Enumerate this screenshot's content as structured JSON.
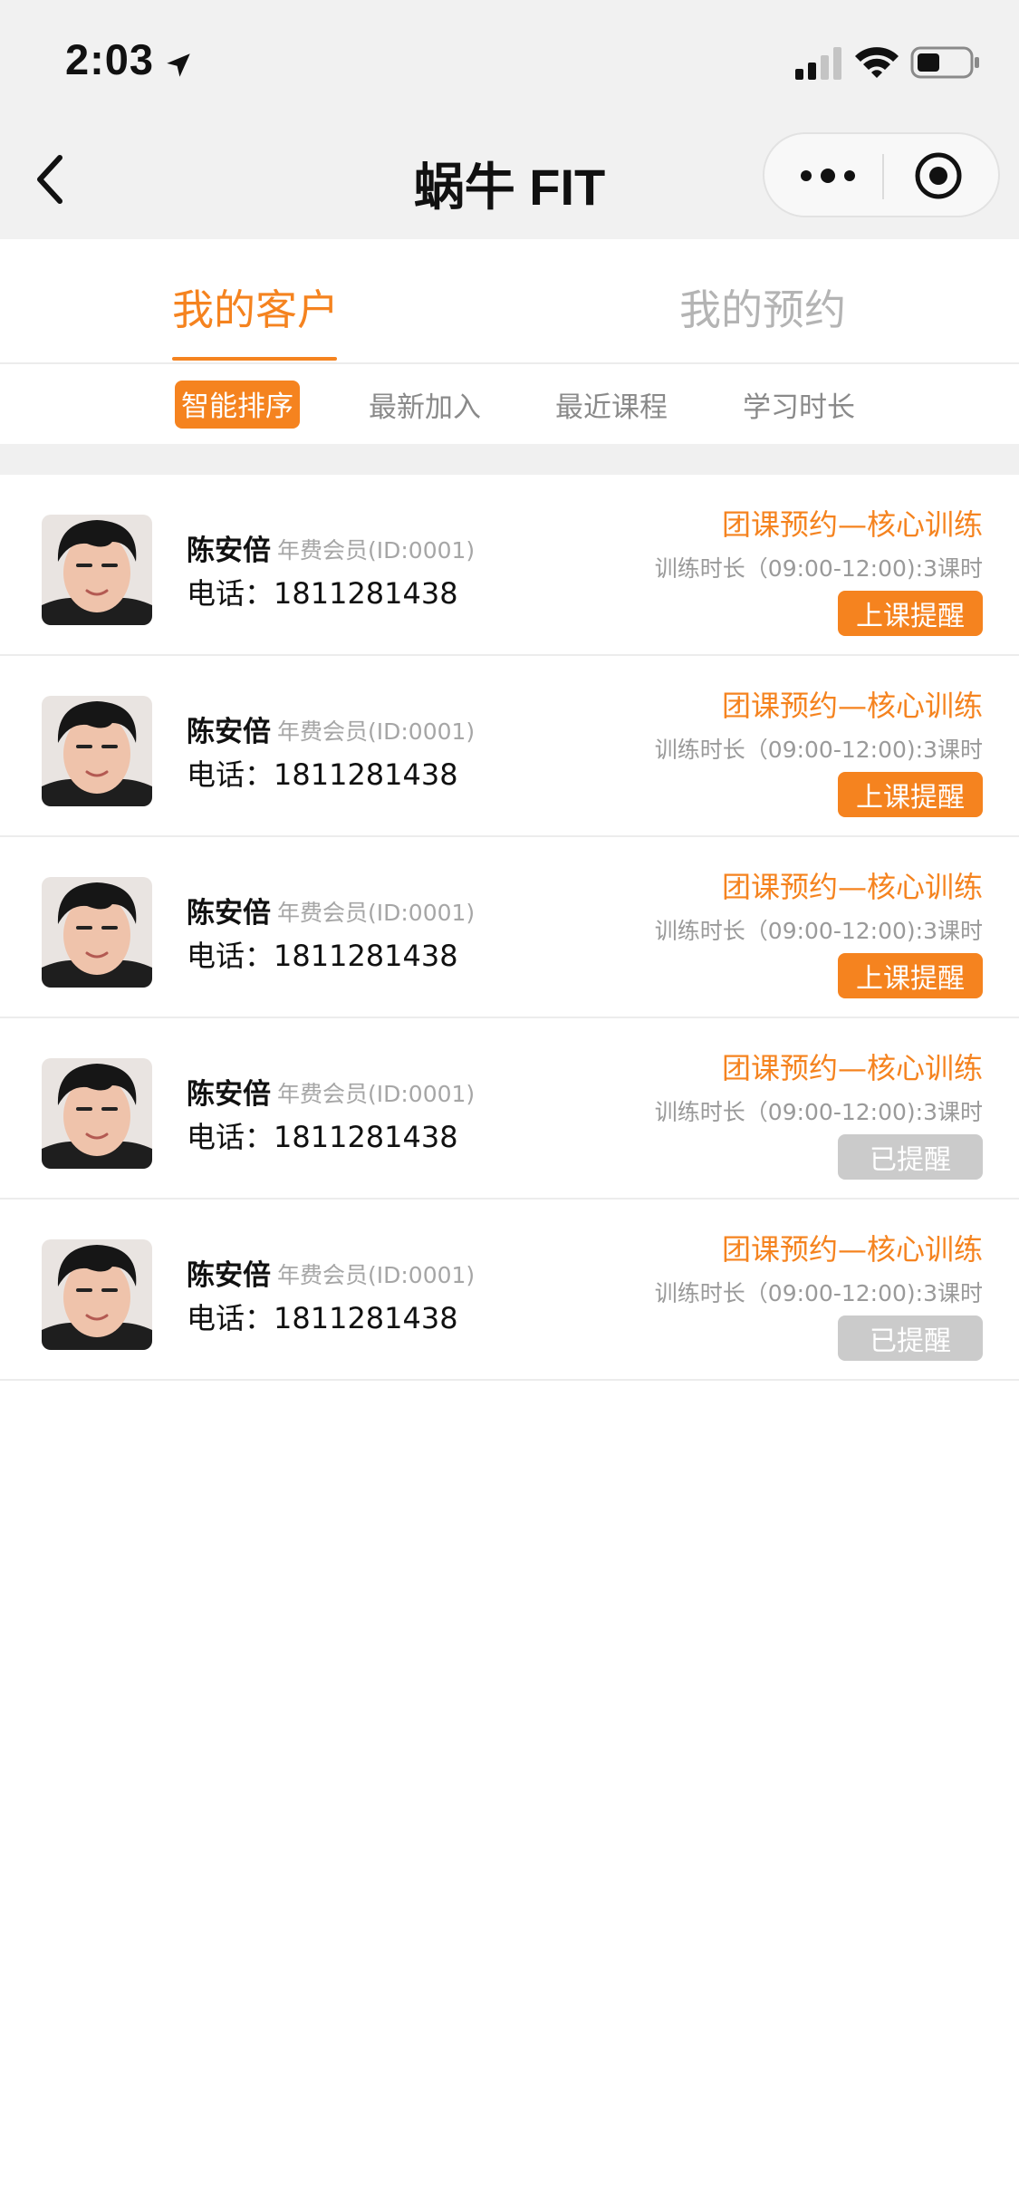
{
  "status_bar": {
    "time": "2:03"
  },
  "nav": {
    "title": "蜗牛 FIT"
  },
  "tabs": [
    {
      "label": "我的客户",
      "active": true
    },
    {
      "label": "我的预约",
      "active": false
    }
  ],
  "sort_options": [
    {
      "label": "智能排序",
      "active": true
    },
    {
      "label": "最新加入",
      "active": false
    },
    {
      "label": "最近课程",
      "active": false
    },
    {
      "label": "学习时长",
      "active": false
    }
  ],
  "customers": [
    {
      "name": "陈安倍",
      "membership": "年费会员(ID:0001)",
      "phone": "电话：1811281438",
      "course": "团课预约—核心训练",
      "duration": "训练时长（09:00-12:00):3课时",
      "action": "上课提醒",
      "reminded": false
    },
    {
      "name": "陈安倍",
      "membership": "年费会员(ID:0001)",
      "phone": "电话：1811281438",
      "course": "团课预约—核心训练",
      "duration": "训练时长（09:00-12:00):3课时",
      "action": "上课提醒",
      "reminded": false
    },
    {
      "name": "陈安倍",
      "membership": "年费会员(ID:0001)",
      "phone": "电话：1811281438",
      "course": "团课预约—核心训练",
      "duration": "训练时长（09:00-12:00):3课时",
      "action": "上课提醒",
      "reminded": false
    },
    {
      "name": "陈安倍",
      "membership": "年费会员(ID:0001)",
      "phone": "电话：1811281438",
      "course": "团课预约—核心训练",
      "duration": "训练时长（09:00-12:00):3课时",
      "action": "已提醒",
      "reminded": true
    },
    {
      "name": "陈安倍",
      "membership": "年费会员(ID:0001)",
      "phone": "电话：1811281438",
      "course": "团课预约—核心训练",
      "duration": "训练时长（09:00-12:00):3课时",
      "action": "已提醒",
      "reminded": true
    }
  ],
  "colors": {
    "accent": "#f5831f",
    "reminded": "#cbcbcb",
    "muted": "#a6a6a6"
  },
  "icons": [
    "location-arrow-icon",
    "signal-icon",
    "wifi-icon",
    "battery-icon",
    "back-chevron-icon",
    "more-dots-icon",
    "close-target-icon",
    "avatar-photo"
  ]
}
